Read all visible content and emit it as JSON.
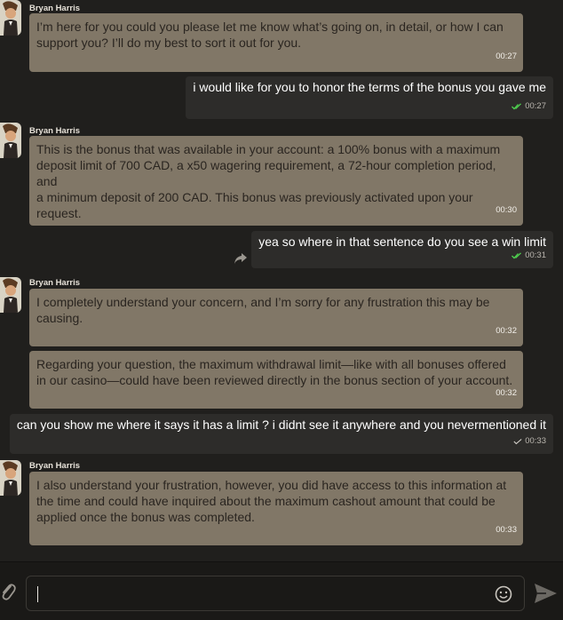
{
  "colors": {
    "background": "#201f1d",
    "agent_bubble": "#817767",
    "user_bubble": "#2d2c2a",
    "read_check": "#4fd14f"
  },
  "messages": [
    {
      "from": "agent",
      "sender": "Bryan Harris",
      "bubbles": [
        {
          "lines": [
            "I’m here for you could you please let me know what’s going on, in detail, or how I can",
            "support you? I’ll do my best to sort it out for you."
          ],
          "time": "00:27"
        }
      ]
    },
    {
      "from": "user",
      "text": "i would like for you to honor the terms of the bonus you gave me",
      "time": "00:27",
      "status": "read"
    },
    {
      "from": "agent",
      "sender": "Bryan Harris",
      "bubbles": [
        {
          "lines": [
            "This is the bonus that was available in your account: a 100% bonus with a maximum",
            "deposit limit of 700 CAD, a x50 wagering requirement, a 72-hour completion period, and",
            "a minimum deposit of 200 CAD. This bonus was previously activated upon your",
            "request."
          ],
          "time": "00:30"
        }
      ]
    },
    {
      "from": "user",
      "text": "yea so where in that sentence do you see a win limit",
      "time": "00:31",
      "status": "read",
      "share_icon": "share-arrow-icon"
    },
    {
      "from": "agent",
      "sender": "Bryan Harris",
      "bubbles": [
        {
          "lines": [
            "I completely understand your concern, and I’m sorry for any frustration this may be",
            "causing."
          ],
          "time": "00:32"
        },
        {
          "lines": [
            "Regarding your question, the maximum withdrawal limit—like with all bonuses offered",
            "in our casino—could have been reviewed directly in the bonus section of your account."
          ],
          "time": "00:32"
        }
      ]
    },
    {
      "from": "user",
      "text": "can you show me where it says it has a limit ? i didnt see it anywhere and you nevermentioned it",
      "time": "00:33",
      "status": "sent"
    },
    {
      "from": "agent",
      "sender": "Bryan Harris",
      "bubbles": [
        {
          "lines": [
            "I also understand your frustration, however, you did have access to this information at",
            "the time and could have inquired about the maximum cashout amount that could be",
            "applied once the bonus was completed."
          ],
          "time": "00:33"
        }
      ]
    }
  ],
  "composer": {
    "value": "",
    "placeholder": "",
    "attach_icon": "paperclip-icon",
    "emoji_icon": "smiley-icon",
    "send_icon": "send-icon"
  }
}
